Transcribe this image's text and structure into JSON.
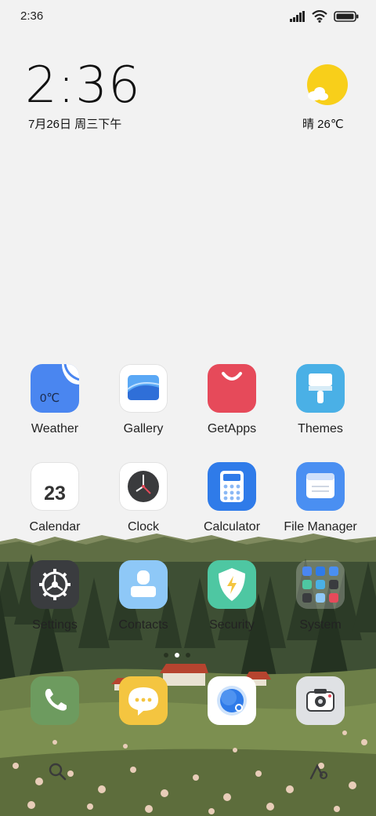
{
  "status_bar": {
    "time": "2:36"
  },
  "clock_widget": {
    "time": "2:36",
    "date": "7月26日 周三下午"
  },
  "weather_widget": {
    "text": "晴 26℃"
  },
  "apps": [
    {
      "label": "Weather",
      "icon": "weather-icon",
      "badge": "0℃"
    },
    {
      "label": "Gallery",
      "icon": "gallery-icon"
    },
    {
      "label": "GetApps",
      "icon": "getapps-icon"
    },
    {
      "label": "Themes",
      "icon": "themes-icon"
    },
    {
      "label": "Calendar",
      "icon": "calendar-icon",
      "badge": "23"
    },
    {
      "label": "Clock",
      "icon": "clock-icon"
    },
    {
      "label": "Calculator",
      "icon": "calculator-icon"
    },
    {
      "label": "File Manager",
      "icon": "file-manager-icon"
    },
    {
      "label": "Settings",
      "icon": "settings-icon"
    },
    {
      "label": "Contacts",
      "icon": "contacts-icon"
    },
    {
      "label": "Security",
      "icon": "security-icon"
    },
    {
      "label": "System",
      "icon": "system-folder-icon"
    }
  ],
  "dock": [
    {
      "name": "Phone",
      "icon": "phone-icon"
    },
    {
      "name": "Messaging",
      "icon": "messaging-icon"
    },
    {
      "name": "Browser",
      "icon": "browser-icon"
    },
    {
      "name": "Camera",
      "icon": "camera-icon"
    }
  ],
  "pages": {
    "count": 3,
    "active": 2
  },
  "colors": {
    "background": "#f2f2f2",
    "weather_blue": "#4a86f0",
    "getapps_red": "#e64a5a",
    "themes_blue": "#4ab0e6",
    "calculator_blue": "#2f7be9",
    "security_green": "#4ec7a2",
    "phone_green": "#6d9b5f",
    "messaging_yellow": "#f4c540",
    "sun_yellow": "#f8cf1a"
  }
}
